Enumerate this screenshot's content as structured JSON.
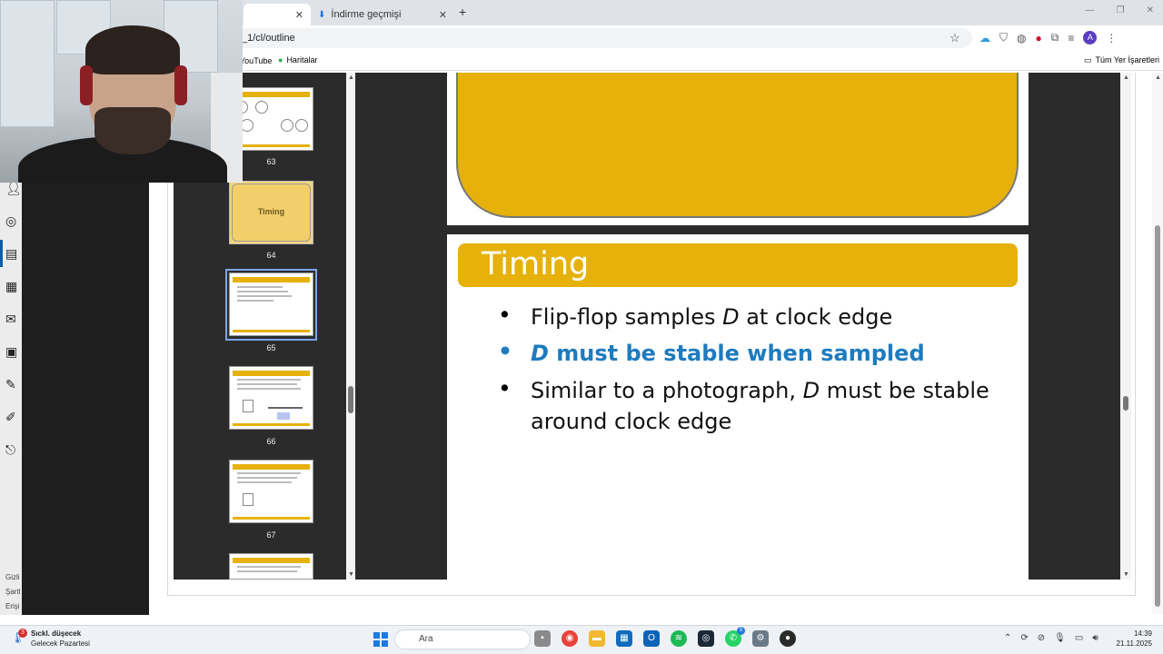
{
  "browser": {
    "tabs": [
      {
        "label": ""
      },
      {
        "label": "İndirme geçmişi"
      }
    ],
    "url": "_1/cl/outline",
    "bookmarks": {
      "youtube": "YouTube",
      "maps": "Haritalar",
      "all": "Tüm Yer İşaretleri"
    },
    "profile_initial": "A"
  },
  "sidebar": {
    "footer": [
      "Gizli",
      "Şartl",
      "Erişi"
    ]
  },
  "thumbnails": {
    "items": [
      {
        "number": "63"
      },
      {
        "number": "64",
        "title": "Timing"
      },
      {
        "number": "65"
      },
      {
        "number": "66"
      },
      {
        "number": "67"
      }
    ]
  },
  "slide": {
    "title": "Timing",
    "bullets": [
      {
        "before": "Flip-flop samples ",
        "em": "D",
        "after": " at clock edge"
      },
      {
        "before": "",
        "em": "D",
        "after": " must be stable when sampled"
      },
      {
        "before": "Similar to a photograph, ",
        "em": "D",
        "after": " must be stable around clock edge"
      }
    ],
    "bullet_char": "•",
    "accent_color": "#e6b10a",
    "highlight_color": "#1e7bbf"
  },
  "taskbar": {
    "weather_badge": "3",
    "weather_line1": "Sıckl. düşecek",
    "weather_line2": "Gelecek Pazartesi",
    "search_placeholder": "Ara",
    "messaging_badge": "5",
    "time": "14:39",
    "date": "21.11.2025"
  }
}
